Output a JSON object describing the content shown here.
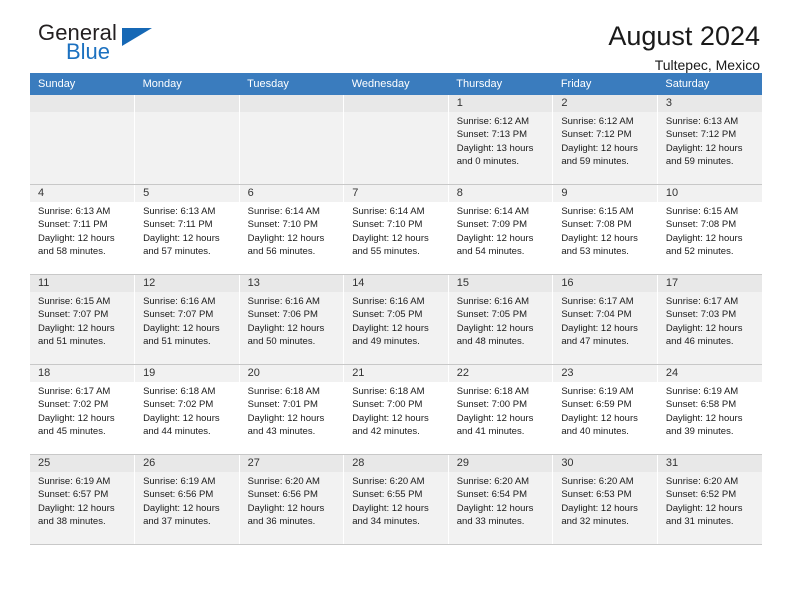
{
  "logo": {
    "line1": "General",
    "line2": "Blue",
    "triangle_icon": "logo-triangle-icon",
    "accent_color": "#1668b5"
  },
  "header": {
    "title": "August 2024",
    "subtitle": "Tultepec, Mexico"
  },
  "theme": {
    "header_bg": "#3a7cbe",
    "alt_row_bg": "#f2f2f2",
    "daynum_bg": "#f1f1f1",
    "grid_line": "#c8c8c8"
  },
  "weekdays": [
    "Sunday",
    "Monday",
    "Tuesday",
    "Wednesday",
    "Thursday",
    "Friday",
    "Saturday"
  ],
  "weeks": [
    [
      {
        "day": "",
        "empty": true
      },
      {
        "day": "",
        "empty": true
      },
      {
        "day": "",
        "empty": true
      },
      {
        "day": "",
        "empty": true
      },
      {
        "day": "1",
        "sunrise": "Sunrise: 6:12 AM",
        "sunset": "Sunset: 7:13 PM",
        "daylight1": "Daylight: 13 hours",
        "daylight2": "and 0 minutes."
      },
      {
        "day": "2",
        "sunrise": "Sunrise: 6:12 AM",
        "sunset": "Sunset: 7:12 PM",
        "daylight1": "Daylight: 12 hours",
        "daylight2": "and 59 minutes."
      },
      {
        "day": "3",
        "sunrise": "Sunrise: 6:13 AM",
        "sunset": "Sunset: 7:12 PM",
        "daylight1": "Daylight: 12 hours",
        "daylight2": "and 59 minutes."
      }
    ],
    [
      {
        "day": "4",
        "sunrise": "Sunrise: 6:13 AM",
        "sunset": "Sunset: 7:11 PM",
        "daylight1": "Daylight: 12 hours",
        "daylight2": "and 58 minutes."
      },
      {
        "day": "5",
        "sunrise": "Sunrise: 6:13 AM",
        "sunset": "Sunset: 7:11 PM",
        "daylight1": "Daylight: 12 hours",
        "daylight2": "and 57 minutes."
      },
      {
        "day": "6",
        "sunrise": "Sunrise: 6:14 AM",
        "sunset": "Sunset: 7:10 PM",
        "daylight1": "Daylight: 12 hours",
        "daylight2": "and 56 minutes."
      },
      {
        "day": "7",
        "sunrise": "Sunrise: 6:14 AM",
        "sunset": "Sunset: 7:10 PM",
        "daylight1": "Daylight: 12 hours",
        "daylight2": "and 55 minutes."
      },
      {
        "day": "8",
        "sunrise": "Sunrise: 6:14 AM",
        "sunset": "Sunset: 7:09 PM",
        "daylight1": "Daylight: 12 hours",
        "daylight2": "and 54 minutes."
      },
      {
        "day": "9",
        "sunrise": "Sunrise: 6:15 AM",
        "sunset": "Sunset: 7:08 PM",
        "daylight1": "Daylight: 12 hours",
        "daylight2": "and 53 minutes."
      },
      {
        "day": "10",
        "sunrise": "Sunrise: 6:15 AM",
        "sunset": "Sunset: 7:08 PM",
        "daylight1": "Daylight: 12 hours",
        "daylight2": "and 52 minutes."
      }
    ],
    [
      {
        "day": "11",
        "sunrise": "Sunrise: 6:15 AM",
        "sunset": "Sunset: 7:07 PM",
        "daylight1": "Daylight: 12 hours",
        "daylight2": "and 51 minutes."
      },
      {
        "day": "12",
        "sunrise": "Sunrise: 6:16 AM",
        "sunset": "Sunset: 7:07 PM",
        "daylight1": "Daylight: 12 hours",
        "daylight2": "and 51 minutes."
      },
      {
        "day": "13",
        "sunrise": "Sunrise: 6:16 AM",
        "sunset": "Sunset: 7:06 PM",
        "daylight1": "Daylight: 12 hours",
        "daylight2": "and 50 minutes."
      },
      {
        "day": "14",
        "sunrise": "Sunrise: 6:16 AM",
        "sunset": "Sunset: 7:05 PM",
        "daylight1": "Daylight: 12 hours",
        "daylight2": "and 49 minutes."
      },
      {
        "day": "15",
        "sunrise": "Sunrise: 6:16 AM",
        "sunset": "Sunset: 7:05 PM",
        "daylight1": "Daylight: 12 hours",
        "daylight2": "and 48 minutes."
      },
      {
        "day": "16",
        "sunrise": "Sunrise: 6:17 AM",
        "sunset": "Sunset: 7:04 PM",
        "daylight1": "Daylight: 12 hours",
        "daylight2": "and 47 minutes."
      },
      {
        "day": "17",
        "sunrise": "Sunrise: 6:17 AM",
        "sunset": "Sunset: 7:03 PM",
        "daylight1": "Daylight: 12 hours",
        "daylight2": "and 46 minutes."
      }
    ],
    [
      {
        "day": "18",
        "sunrise": "Sunrise: 6:17 AM",
        "sunset": "Sunset: 7:02 PM",
        "daylight1": "Daylight: 12 hours",
        "daylight2": "and 45 minutes."
      },
      {
        "day": "19",
        "sunrise": "Sunrise: 6:18 AM",
        "sunset": "Sunset: 7:02 PM",
        "daylight1": "Daylight: 12 hours",
        "daylight2": "and 44 minutes."
      },
      {
        "day": "20",
        "sunrise": "Sunrise: 6:18 AM",
        "sunset": "Sunset: 7:01 PM",
        "daylight1": "Daylight: 12 hours",
        "daylight2": "and 43 minutes."
      },
      {
        "day": "21",
        "sunrise": "Sunrise: 6:18 AM",
        "sunset": "Sunset: 7:00 PM",
        "daylight1": "Daylight: 12 hours",
        "daylight2": "and 42 minutes."
      },
      {
        "day": "22",
        "sunrise": "Sunrise: 6:18 AM",
        "sunset": "Sunset: 7:00 PM",
        "daylight1": "Daylight: 12 hours",
        "daylight2": "and 41 minutes."
      },
      {
        "day": "23",
        "sunrise": "Sunrise: 6:19 AM",
        "sunset": "Sunset: 6:59 PM",
        "daylight1": "Daylight: 12 hours",
        "daylight2": "and 40 minutes."
      },
      {
        "day": "24",
        "sunrise": "Sunrise: 6:19 AM",
        "sunset": "Sunset: 6:58 PM",
        "daylight1": "Daylight: 12 hours",
        "daylight2": "and 39 minutes."
      }
    ],
    [
      {
        "day": "25",
        "sunrise": "Sunrise: 6:19 AM",
        "sunset": "Sunset: 6:57 PM",
        "daylight1": "Daylight: 12 hours",
        "daylight2": "and 38 minutes."
      },
      {
        "day": "26",
        "sunrise": "Sunrise: 6:19 AM",
        "sunset": "Sunset: 6:56 PM",
        "daylight1": "Daylight: 12 hours",
        "daylight2": "and 37 minutes."
      },
      {
        "day": "27",
        "sunrise": "Sunrise: 6:20 AM",
        "sunset": "Sunset: 6:56 PM",
        "daylight1": "Daylight: 12 hours",
        "daylight2": "and 36 minutes."
      },
      {
        "day": "28",
        "sunrise": "Sunrise: 6:20 AM",
        "sunset": "Sunset: 6:55 PM",
        "daylight1": "Daylight: 12 hours",
        "daylight2": "and 34 minutes."
      },
      {
        "day": "29",
        "sunrise": "Sunrise: 6:20 AM",
        "sunset": "Sunset: 6:54 PM",
        "daylight1": "Daylight: 12 hours",
        "daylight2": "and 33 minutes."
      },
      {
        "day": "30",
        "sunrise": "Sunrise: 6:20 AM",
        "sunset": "Sunset: 6:53 PM",
        "daylight1": "Daylight: 12 hours",
        "daylight2": "and 32 minutes."
      },
      {
        "day": "31",
        "sunrise": "Sunrise: 6:20 AM",
        "sunset": "Sunset: 6:52 PM",
        "daylight1": "Daylight: 12 hours",
        "daylight2": "and 31 minutes."
      }
    ]
  ]
}
